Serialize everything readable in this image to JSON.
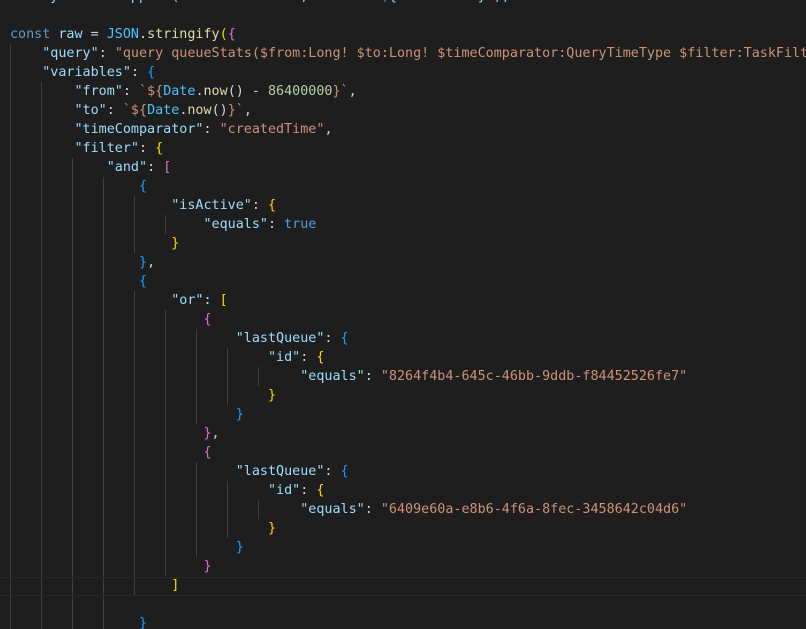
{
  "colors": {
    "background": "#1e1e1e",
    "keyword": "#569cd6",
    "variable": "#9cdcfe",
    "function": "#dcdcaa",
    "class": "#4fc1ff",
    "string": "#ce9178",
    "number": "#b5cea8",
    "punctuation": "#d4d4d4",
    "bracket_level1": "#ffd700",
    "bracket_level2": "#da70d6",
    "bracket_level3": "#179fff",
    "indent_guide": "#404040"
  },
  "code": {
    "lines": [
      [
        [
          "    myHeaders.append(\"Authorization\", \"Bearer ${this.token}\");",
          "var"
        ]
      ],
      [],
      [
        [
          "const ",
          "kw"
        ],
        [
          "raw",
          "var"
        ],
        [
          " = ",
          "pun"
        ],
        [
          "JSON",
          "cls"
        ],
        [
          ".",
          "pun"
        ],
        [
          "stringify",
          "fn"
        ],
        [
          "(",
          "b1"
        ],
        [
          "{",
          "b2"
        ]
      ],
      [
        [
          "    ",
          "pun"
        ],
        [
          "\"query\"",
          "var"
        ],
        [
          ": ",
          "pun"
        ],
        [
          "\"query queueStats($from:Long! $to:Long! $timeComparator:QueryTimeType $filter:TaskFilte",
          "str"
        ]
      ],
      [
        [
          "    ",
          "pun"
        ],
        [
          "\"variables\"",
          "var"
        ],
        [
          ": ",
          "pun"
        ],
        [
          "{",
          "b3"
        ]
      ],
      [
        [
          "        ",
          "pun"
        ],
        [
          "\"from\"",
          "var"
        ],
        [
          ": ",
          "pun"
        ],
        [
          "`${",
          "str"
        ],
        [
          "Date",
          "cls"
        ],
        [
          ".",
          "pun"
        ],
        [
          "now",
          "fn"
        ],
        [
          "() - ",
          "pun"
        ],
        [
          "86400000",
          "num"
        ],
        [
          "}`",
          "str"
        ],
        [
          ",",
          "pun"
        ]
      ],
      [
        [
          "        ",
          "pun"
        ],
        [
          "\"to\"",
          "var"
        ],
        [
          ": ",
          "pun"
        ],
        [
          "`${",
          "str"
        ],
        [
          "Date",
          "cls"
        ],
        [
          ".",
          "pun"
        ],
        [
          "now",
          "fn"
        ],
        [
          "()",
          "pun"
        ],
        [
          "}`",
          "str"
        ],
        [
          ",",
          "pun"
        ]
      ],
      [
        [
          "        ",
          "pun"
        ],
        [
          "\"timeComparator\"",
          "var"
        ],
        [
          ": ",
          "pun"
        ],
        [
          "\"createdTime\"",
          "str"
        ],
        [
          ",",
          "pun"
        ]
      ],
      [
        [
          "        ",
          "pun"
        ],
        [
          "\"filter\"",
          "var"
        ],
        [
          ": ",
          "pun"
        ],
        [
          "{",
          "b1"
        ]
      ],
      [
        [
          "            ",
          "pun"
        ],
        [
          "\"and\"",
          "var"
        ],
        [
          ": ",
          "pun"
        ],
        [
          "[",
          "b2"
        ]
      ],
      [
        [
          "                ",
          "pun"
        ],
        [
          "{",
          "b3"
        ]
      ],
      [
        [
          "                    ",
          "pun"
        ],
        [
          "\"isActive\"",
          "var"
        ],
        [
          ": ",
          "pun"
        ],
        [
          "{",
          "b1"
        ]
      ],
      [
        [
          "                        ",
          "pun"
        ],
        [
          "\"equals\"",
          "var"
        ],
        [
          ": ",
          "pun"
        ],
        [
          "true",
          "kw"
        ]
      ],
      [
        [
          "                    ",
          "pun"
        ],
        [
          "}",
          "b1"
        ]
      ],
      [
        [
          "                ",
          "pun"
        ],
        [
          "}",
          "b3"
        ],
        [
          ",",
          "pun"
        ]
      ],
      [
        [
          "                ",
          "pun"
        ],
        [
          "{",
          "b3"
        ]
      ],
      [
        [
          "                    ",
          "pun"
        ],
        [
          "\"or\"",
          "var"
        ],
        [
          ": ",
          "pun"
        ],
        [
          "[",
          "b1"
        ]
      ],
      [
        [
          "                        ",
          "pun"
        ],
        [
          "{",
          "b2"
        ]
      ],
      [
        [
          "                            ",
          "pun"
        ],
        [
          "\"lastQueue\"",
          "var"
        ],
        [
          ": ",
          "pun"
        ],
        [
          "{",
          "b3"
        ]
      ],
      [
        [
          "                                ",
          "pun"
        ],
        [
          "\"id\"",
          "var"
        ],
        [
          ": ",
          "pun"
        ],
        [
          "{",
          "b1"
        ]
      ],
      [
        [
          "                                    ",
          "pun"
        ],
        [
          "\"equals\"",
          "var"
        ],
        [
          ": ",
          "pun"
        ],
        [
          "\"8264f4b4-645c-46bb-9ddb-f84452526fe7\"",
          "str"
        ]
      ],
      [
        [
          "                                ",
          "pun"
        ],
        [
          "}",
          "b1"
        ]
      ],
      [
        [
          "                            ",
          "pun"
        ],
        [
          "}",
          "b3"
        ]
      ],
      [
        [
          "                        ",
          "pun"
        ],
        [
          "}",
          "b2"
        ],
        [
          ",",
          "pun"
        ]
      ],
      [
        [
          "                        ",
          "pun"
        ],
        [
          "{",
          "b2"
        ]
      ],
      [
        [
          "                            ",
          "pun"
        ],
        [
          "\"lastQueue\"",
          "var"
        ],
        [
          ": ",
          "pun"
        ],
        [
          "{",
          "b3"
        ]
      ],
      [
        [
          "                                ",
          "pun"
        ],
        [
          "\"id\"",
          "var"
        ],
        [
          ": ",
          "pun"
        ],
        [
          "{",
          "b1"
        ]
      ],
      [
        [
          "                                    ",
          "pun"
        ],
        [
          "\"equals\"",
          "var"
        ],
        [
          ": ",
          "pun"
        ],
        [
          "\"6409e60a-e8b6-4f6a-8fec-3458642c04d6\"",
          "str"
        ]
      ],
      [
        [
          "                                ",
          "pun"
        ],
        [
          "}",
          "b1"
        ]
      ],
      [
        [
          "                            ",
          "pun"
        ],
        [
          "}",
          "b3"
        ]
      ],
      [
        [
          "                        ",
          "pun"
        ],
        [
          "}",
          "b2"
        ]
      ],
      [
        [
          "                    ",
          "pun"
        ],
        [
          "]",
          "b1"
        ]
      ],
      [],
      [
        [
          "                ",
          "pun"
        ],
        [
          "}",
          "b3"
        ]
      ]
    ]
  }
}
